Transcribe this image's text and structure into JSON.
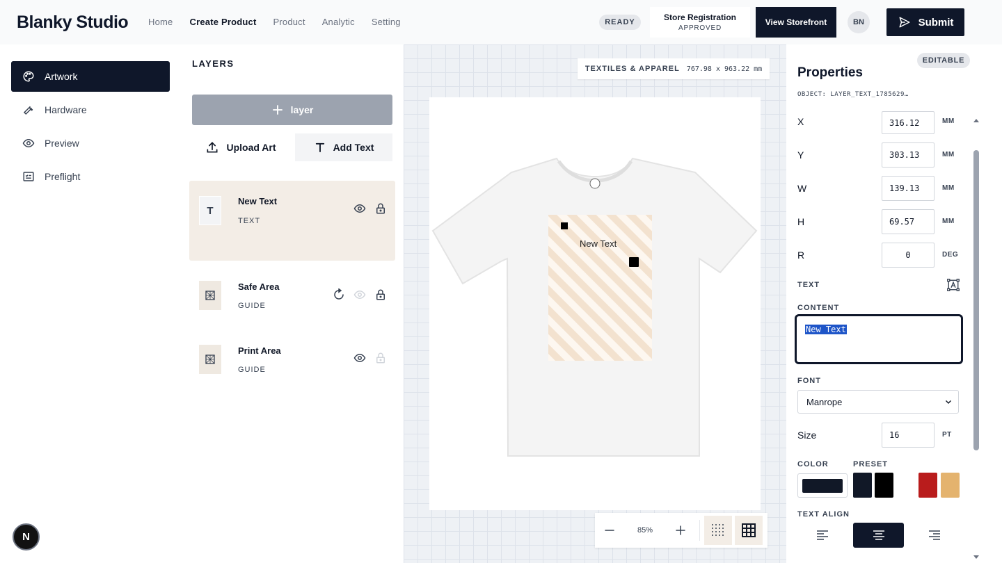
{
  "app": {
    "title": "Blanky Studio"
  },
  "nav": [
    "Home",
    "Create Product",
    "Product",
    "Analytic",
    "Setting"
  ],
  "header": {
    "status": "READY",
    "store_title": "Store Registration",
    "store_status": "APPROVED",
    "view_storefront": "View Storefront",
    "avatar": "BN",
    "submit": "Submit"
  },
  "sidebar": {
    "items": [
      {
        "label": "Artwork",
        "icon": "palette-icon"
      },
      {
        "label": "Hardware",
        "icon": "wrench-icon"
      },
      {
        "label": "Preview",
        "icon": "eye-icon"
      },
      {
        "label": "Preflight",
        "icon": "checklist-icon"
      }
    ],
    "badge": "N"
  },
  "layers": {
    "title": "LAYERS",
    "add_label": "layer",
    "upload_label": "Upload Art",
    "add_text_label": "Add Text",
    "items": [
      {
        "name": "New Text",
        "type": "TEXT",
        "thumb": "T"
      },
      {
        "name": "Safe Area",
        "type": "GUIDE"
      },
      {
        "name": "Print Area",
        "type": "GUIDE"
      }
    ]
  },
  "canvas": {
    "category": "TEXTILES & APPAREL",
    "dimensions": "767.98 x 963.22 mm",
    "text_on_shirt": "New Text",
    "zoom": "85%"
  },
  "properties": {
    "badge": "EDITABLE",
    "title": "Properties",
    "object_id": "OBJECT: LAYER_TEXT_1785629…",
    "fields": [
      {
        "label": "X",
        "value": "316.12",
        "unit": "MM"
      },
      {
        "label": "Y",
        "value": "303.13",
        "unit": "MM"
      },
      {
        "label": "W",
        "value": "139.13",
        "unit": "MM"
      },
      {
        "label": "H",
        "value": "69.57",
        "unit": "MM"
      },
      {
        "label": "R",
        "value": "0",
        "unit": "DEG"
      }
    ],
    "text_section": "TEXT",
    "content_label": "CONTENT",
    "content_value": "New Text",
    "font_label": "FONT",
    "font_value": "Manrope",
    "size_label": "Size",
    "size_value": "16",
    "size_unit": "PT",
    "color_label": "COLOR",
    "preset_label": "PRESET",
    "text_align_label": "TEXT ALIGN",
    "colors": {
      "current": "#111827",
      "presets": [
        "#111827",
        "#000000",
        "#b91c1c",
        "#e4b36e"
      ]
    }
  }
}
